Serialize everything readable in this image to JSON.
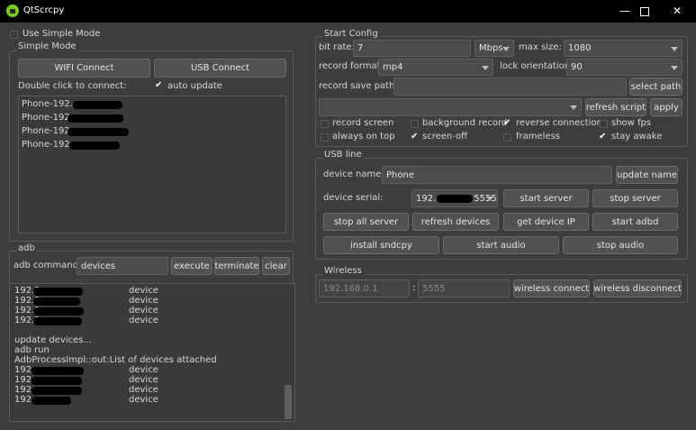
{
  "window": {
    "title": "QtScrcpy",
    "minimize_icon": "minimize-icon",
    "maximize_icon": "maximize-icon",
    "close_icon": "close-icon"
  },
  "simple_mode": {
    "use_label": "Use Simple Mode",
    "group_title": "Simple Mode",
    "wifi_connect": "WIFI Connect",
    "usb_connect": "USB Connect",
    "double_click_label": "Double click to connect:",
    "auto_update": "auto update",
    "devices": [
      "Phone-192.",
      "Phone-192.",
      "Phone-192.",
      "Phone-192."
    ]
  },
  "adb": {
    "group_title": "adb",
    "command_label": "adb command:",
    "command_value": "devices",
    "execute": "execute",
    "terminate": "terminate",
    "clear": "clear",
    "console": {
      "top_ips": [
        "192.1",
        "192.1",
        "192.1",
        "192.1"
      ],
      "device_word": "device",
      "update_devices": "update devices...",
      "adb_run": "adb run",
      "process_out": "AdbProcessImpl::out:List of devices attached",
      "bottom_ips": [
        "192.",
        "192.",
        "192.",
        "192."
      ]
    }
  },
  "start_config": {
    "group_title": "Start Config",
    "bit_rate_label": "bit rate:",
    "bit_rate_value": "7",
    "bit_rate_unit": "Mbps",
    "max_size_label": "max size:",
    "max_size_value": "1080",
    "record_format_label": "record format:",
    "record_format_value": "mp4",
    "lock_orientation_label": "lock orientation:",
    "lock_orientation_value": "90",
    "record_save_path_label": "record save path:",
    "record_save_path_value": "",
    "select_path": "select path",
    "script_value": "",
    "refresh_script": "refresh script",
    "apply": "apply",
    "checks": {
      "record_screen": "record screen",
      "background_record": "background record",
      "reverse_connection": "reverse connection",
      "show_fps": "show fps",
      "always_on_top": "always on top",
      "screen_off": "screen-off",
      "frameless": "frameless",
      "stay_awake": "stay awake"
    }
  },
  "usb_line": {
    "group_title": "USB line",
    "device_name_label": "device name:",
    "device_name_value": "Phone",
    "update_name": "update name",
    "device_serial_label": "device serial:",
    "device_serial_prefix": "192.",
    "device_serial_suffix": "5555",
    "start_server": "start server",
    "stop_server": "stop server",
    "stop_all_server": "stop all server",
    "refresh_devices": "refresh devices",
    "get_device_ip": "get device IP",
    "start_adbd": "start adbd",
    "install_sndcpy": "install sndcpy",
    "start_audio": "start audio",
    "stop_audio": "stop audio"
  },
  "wireless": {
    "group_title": "Wireless",
    "ip_placeholder": "192.168.0.1",
    "separator": ":",
    "port_placeholder": "5555",
    "wireless_connect": "wireless connect",
    "wireless_disconnect": "wireless disconnect"
  }
}
